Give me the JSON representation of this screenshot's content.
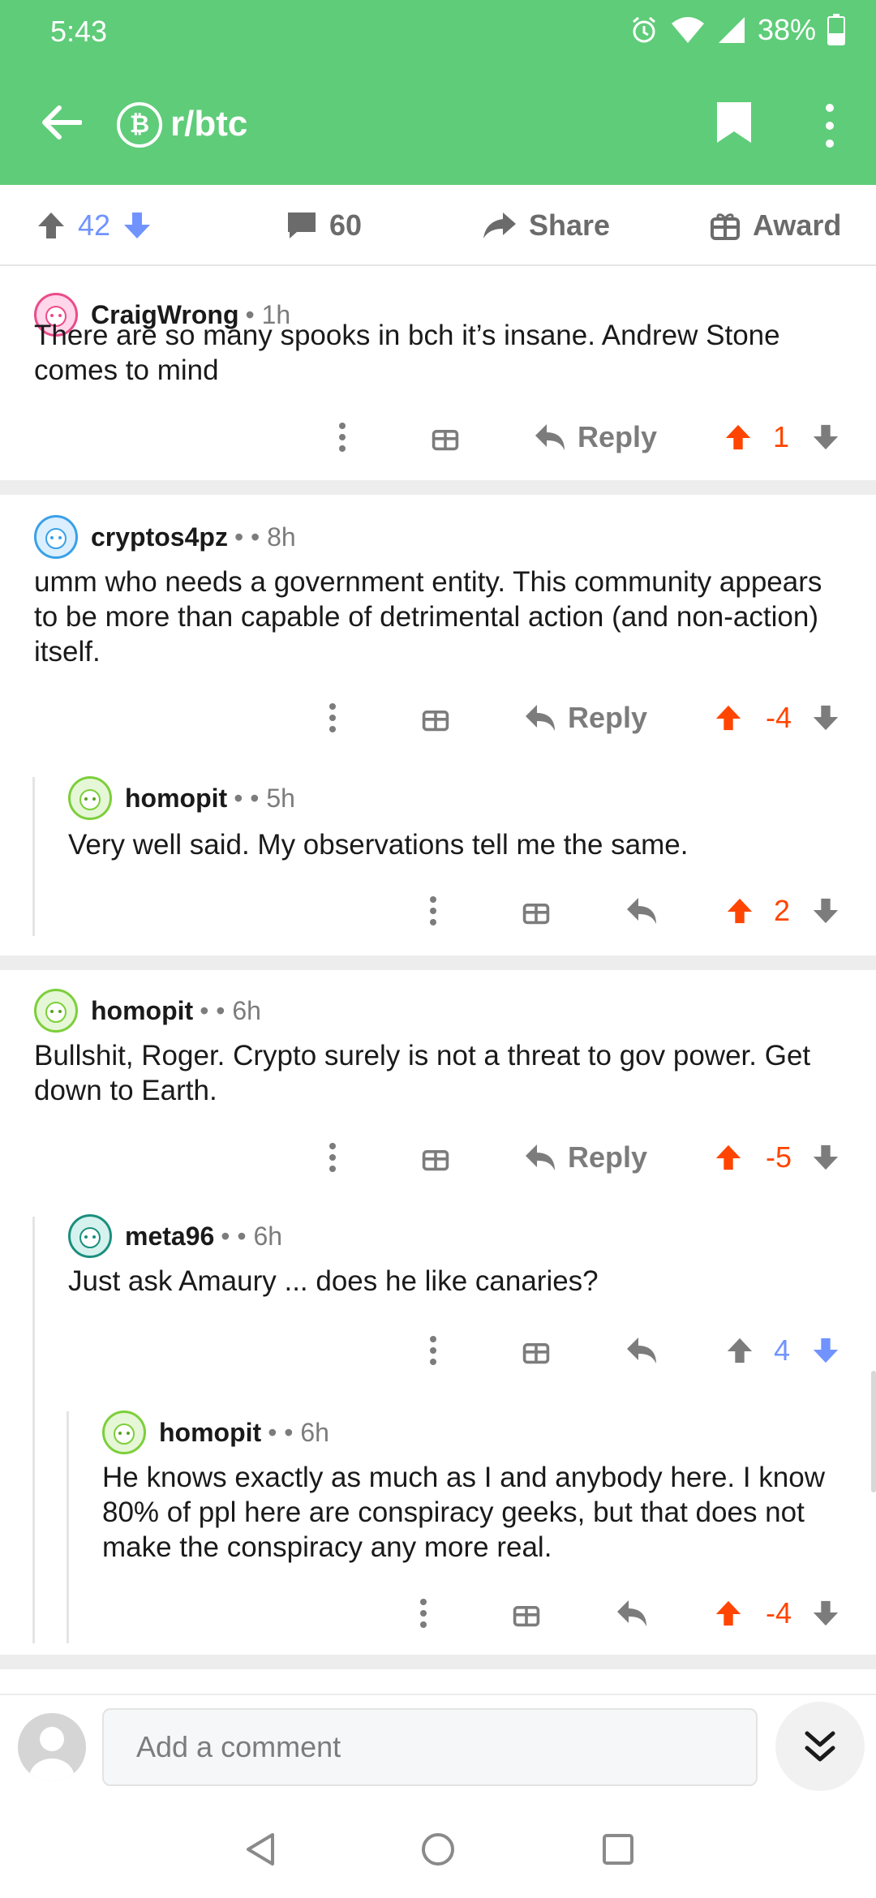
{
  "status_bar": {
    "time": "5:43",
    "battery": "38%",
    "icons": [
      "alarm-icon",
      "wifi-icon",
      "signal-icon",
      "battery-icon"
    ]
  },
  "app_bar": {
    "subreddit": "r/btc",
    "subreddit_icon": "bitcoin-icon",
    "subreddit_icon_glyph": "₿"
  },
  "post_actions": {
    "score": "42",
    "comments": "60",
    "share": "Share",
    "award": "Award"
  },
  "comments": [
    {
      "author": "CraigWrong",
      "meta": "• 1h",
      "body": "There are so many spooks in bch it’s insane. Andrew Stone comes to mind",
      "reply_label": "Reply",
      "score": "1",
      "vote": "up"
    },
    {
      "author": "cryptos4pz",
      "meta": "• • 8h",
      "body": "umm who needs a government entity. This community appears to be more than capable of detrimental action (and non-action) itself.",
      "reply_label": "Reply",
      "score": "-4",
      "vote": "up"
    },
    {
      "author": "homopit",
      "meta": "• • 5h",
      "body": "Very well said. My observations tell me the same.",
      "score": "2",
      "vote": "up"
    },
    {
      "author": "homopit",
      "meta": "• • 6h",
      "body": "Bullshit, Roger. Crypto surely is not a threat to gov power. Get down to Earth.",
      "reply_label": "Reply",
      "score": "-5",
      "vote": "up"
    },
    {
      "author": "meta96",
      "meta": "• • 6h",
      "body": "Just ask Amaury ... does he like canaries?",
      "score": "4",
      "vote": "down"
    },
    {
      "author": "homopit",
      "meta": "• • 6h",
      "body": "He knows exactly as much as I and anybody here. I know 80% of ppl here are conspiracy geeks, but that does not make the conspiracy any more real.",
      "score": "-4",
      "vote": "up"
    }
  ],
  "colors": {
    "header": "#5fcc79",
    "upvote": "#ff4500",
    "downvote": "#7193ff",
    "muted": "#7c7c7c"
  },
  "composer": {
    "placeholder": "Add a comment"
  }
}
